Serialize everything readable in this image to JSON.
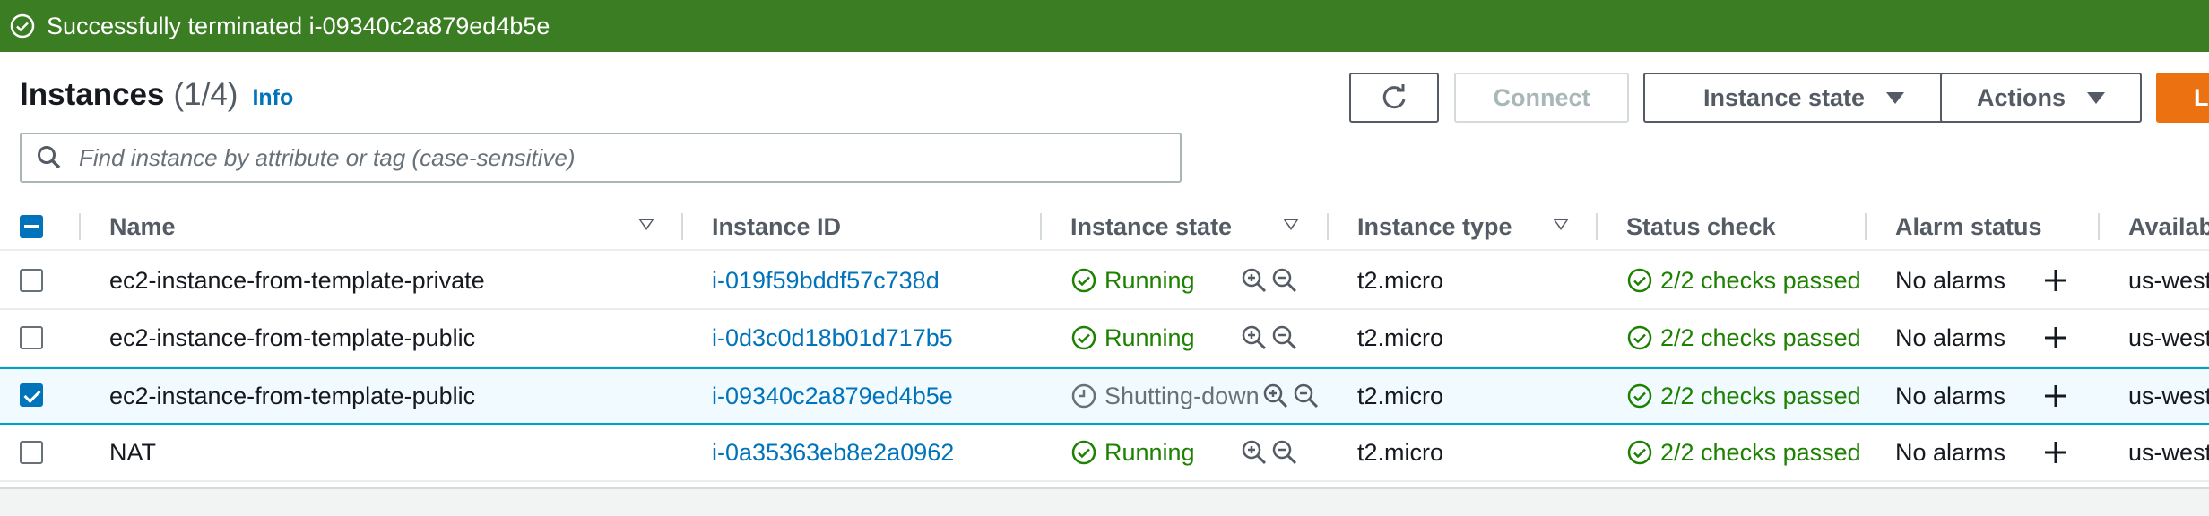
{
  "flash": {
    "message": "Successfully terminated i-09340c2a879ed4b5e",
    "icon": "check-circle-icon",
    "color": "#3b7d23"
  },
  "header": {
    "title": "Instances",
    "count": "(1/4)",
    "info_link": "Info"
  },
  "toolbar": {
    "refresh_icon": "refresh-icon",
    "connect_label": "Connect",
    "instance_state_label": "Instance state",
    "actions_label": "Actions",
    "launch_label": "La"
  },
  "search": {
    "placeholder": "Find instance by attribute or tag (case-sensitive)",
    "value": ""
  },
  "table": {
    "columns": [
      "Name",
      "Instance ID",
      "Instance state",
      "Instance type",
      "Status check",
      "Alarm status",
      "Availab"
    ],
    "rows": [
      {
        "selected": false,
        "name": "ec2-instance-from-template-private",
        "id": "i-019f59bddf57c738d",
        "state": "Running",
        "type": "t2.micro",
        "status": "2/2 checks passed",
        "alarm": "No alarms",
        "az": "us-west"
      },
      {
        "selected": false,
        "name": "ec2-instance-from-template-public",
        "id": "i-0d3c0d18b01d717b5",
        "state": "Running",
        "type": "t2.micro",
        "status": "2/2 checks passed",
        "alarm": "No alarms",
        "az": "us-west"
      },
      {
        "selected": true,
        "name": "ec2-instance-from-template-public",
        "id": "i-09340c2a879ed4b5e",
        "state": "Shutting-down",
        "type": "t2.micro",
        "status": "2/2 checks passed",
        "alarm": "No alarms",
        "az": "us-west"
      },
      {
        "selected": false,
        "name": "NAT",
        "id": "i-0a35363eb8e2a0962",
        "state": "Running",
        "type": "t2.micro",
        "status": "2/2 checks passed",
        "alarm": "No alarms",
        "az": "us-west"
      }
    ]
  },
  "colors": {
    "link": "#0073bb",
    "success": "#1d8102",
    "primary_button": "#ec7211"
  }
}
